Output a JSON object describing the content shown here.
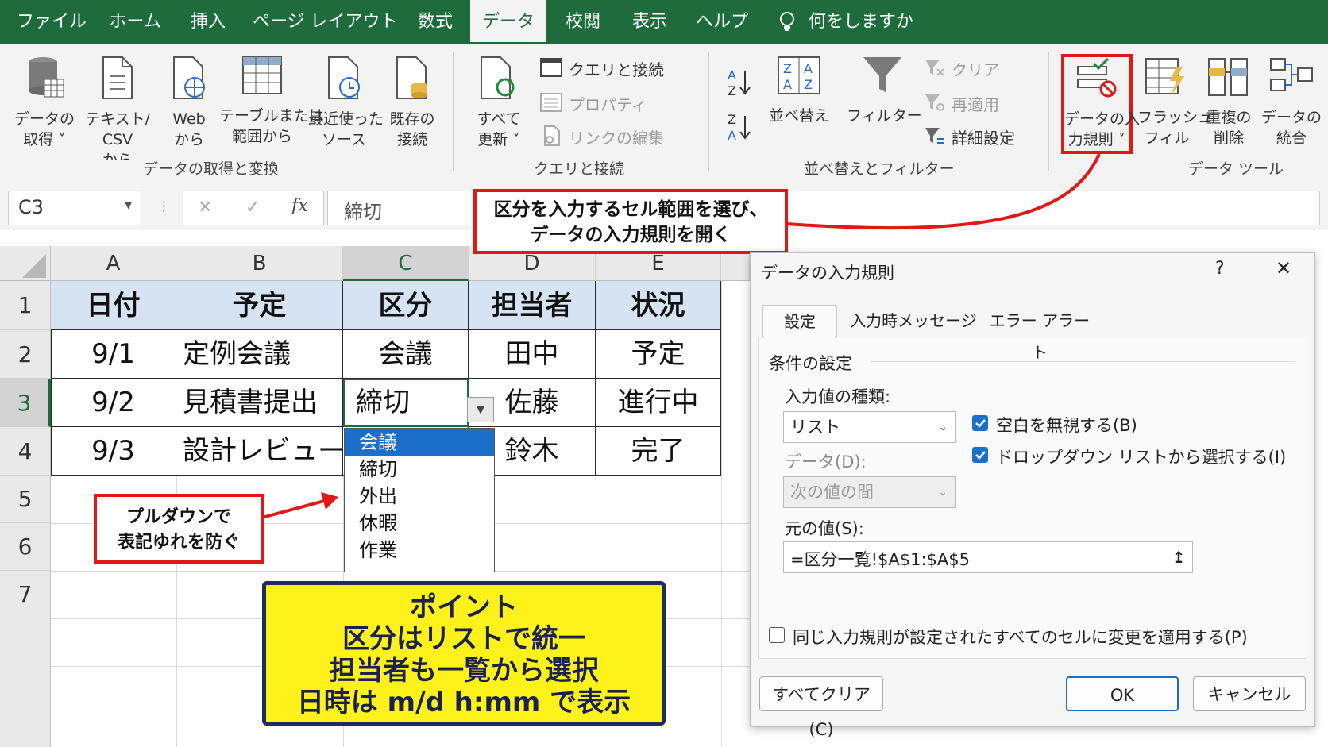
{
  "menu": {
    "tabs": [
      {
        "label": "ファイル"
      },
      {
        "label": "ホーム"
      },
      {
        "label": "挿入"
      },
      {
        "label": "ページ レイアウト"
      },
      {
        "label": "数式"
      },
      {
        "label": "データ"
      },
      {
        "label": "校閲"
      },
      {
        "label": "表示"
      },
      {
        "label": "ヘルプ"
      }
    ],
    "search_label": "何をしますか"
  },
  "ribbon": {
    "get_data": {
      "l1": "データの",
      "l2": "取得 ˅"
    },
    "text_csv": {
      "l1": "テキスト/",
      "l2": "CSV",
      "l3": "から"
    },
    "web": {
      "l1": "Web",
      "l2": "から"
    },
    "table_range": {
      "l1": "テーブルまたは",
      "l2": "範囲から"
    },
    "recent_sources": {
      "l1": "最近使った",
      "l2": "ソース"
    },
    "existing": {
      "l1": "既存の",
      "l2": "接続"
    },
    "group1_label": "データの取得と変換",
    "refresh_all": {
      "l1": "すべて",
      "l2": "更新 ˅"
    },
    "queries_conn": "クエリと接続",
    "properties": "プロパティ",
    "edit_links": "リンクの編集",
    "group2_label": "クエリと接続",
    "sort": "並べ替え",
    "filter": "フィルター",
    "clear": "クリア",
    "reapply": "再適用",
    "advanced": "詳細設定",
    "group3_label": "並べ替えとフィルター",
    "data_validation": {
      "l1": "データの入",
      "l2": "力規則 ˅"
    },
    "flash_fill": {
      "l1": "フラッシュ",
      "l2": "フィル"
    },
    "remove_dup": {
      "l1": "重複の",
      "l2": "削除"
    },
    "consolidate": {
      "l1": "データの",
      "l2": "統合"
    },
    "group4_label": "データ ツール"
  },
  "formula_bar": {
    "name_box": "C3",
    "fx": "fx",
    "value": "締切",
    "cancel": "✕",
    "enter": "✓"
  },
  "sheet": {
    "columns": [
      "A",
      "B",
      "C",
      "D",
      "E"
    ],
    "rows": [
      "1",
      "2",
      "3",
      "4",
      "5",
      "6",
      "7"
    ],
    "header": [
      "日付",
      "予定",
      "区分",
      "担当者",
      "状況"
    ],
    "data": [
      [
        "9/1",
        "定例会議",
        "会議",
        "田中",
        "予定"
      ],
      [
        "9/2",
        "見積書提出",
        "締切",
        "佐藤",
        "進行中"
      ],
      [
        "9/3",
        "設計レビュー",
        "",
        "鈴木",
        "完了"
      ]
    ],
    "dropdown_options": [
      "会議",
      "締切",
      "外出",
      "休暇",
      "作業"
    ]
  },
  "callouts": {
    "top": {
      "l1": "区分を入力するセル範囲を選び、",
      "l2": "データの入力規則を開く"
    },
    "left": {
      "l1": "プルダウンで",
      "l2": "表記ゆれを防ぐ"
    },
    "point": {
      "l1": "ポイント",
      "l2": "区分はリストで統一",
      "l3": "担当者も一覧から選択",
      "l4": "日時は m/d h:mm で表示"
    }
  },
  "dialog": {
    "title": "データの入力規則",
    "help": "?",
    "close": "✕",
    "tabs": [
      "設定",
      "入力時メッセージ",
      "エラー アラート"
    ],
    "section": "条件の設定",
    "allow_label": "入力値の種類:",
    "allow_value": "リスト",
    "data_label": "データ(D):",
    "data_value": "次の値の間",
    "ignore_blank": "空白を無視する(B)",
    "in_cell_dropdown": "ドロップダウン リストから選択する(I)",
    "source_label": "元の値(S):",
    "source_value": "=区分一覧!$A$1:$A$5",
    "apply_all": "同じ入力規則が設定されたすべてのセルに変更を適用する(P)",
    "clear_all": "すべてクリア(C)",
    "ok": "OK",
    "cancel": "キャンセル"
  },
  "colors": {
    "excel_green": "#1e6b3c",
    "highlight_red": "#e01818",
    "point_yellow": "#fff21a",
    "selection_blue": "#1a6fc9",
    "header_fill": "#d5e3f3"
  }
}
